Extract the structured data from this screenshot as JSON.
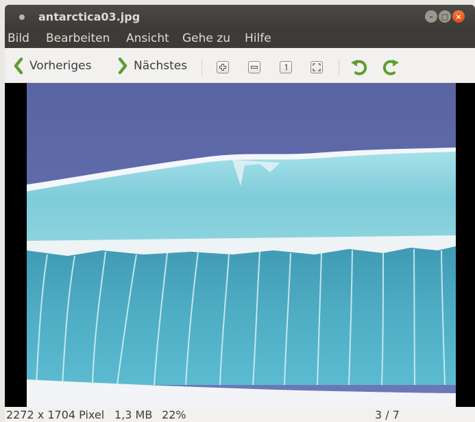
{
  "window": {
    "title": "antarctica03.jpg"
  },
  "menu": {
    "items": [
      "Bild",
      "Bearbeiten",
      "Ansicht",
      "Gehe zu",
      "Hilfe"
    ]
  },
  "toolbar": {
    "previous_label": "Vorheriges",
    "next_label": "Nächstes",
    "tools": [
      "zoom-in-icon",
      "zoom-out-icon",
      "zoom-normal-icon",
      "zoom-fit-icon",
      "rotate-left-icon",
      "rotate-right-icon"
    ],
    "nav_arrow_color": "#5d9e2d",
    "rotate_color": "#5d9e2d"
  },
  "status": {
    "dimensions": "2272 x 1704 Pixel",
    "filesize": "1,3 MB",
    "zoom": "22%",
    "position": "3 / 7"
  }
}
